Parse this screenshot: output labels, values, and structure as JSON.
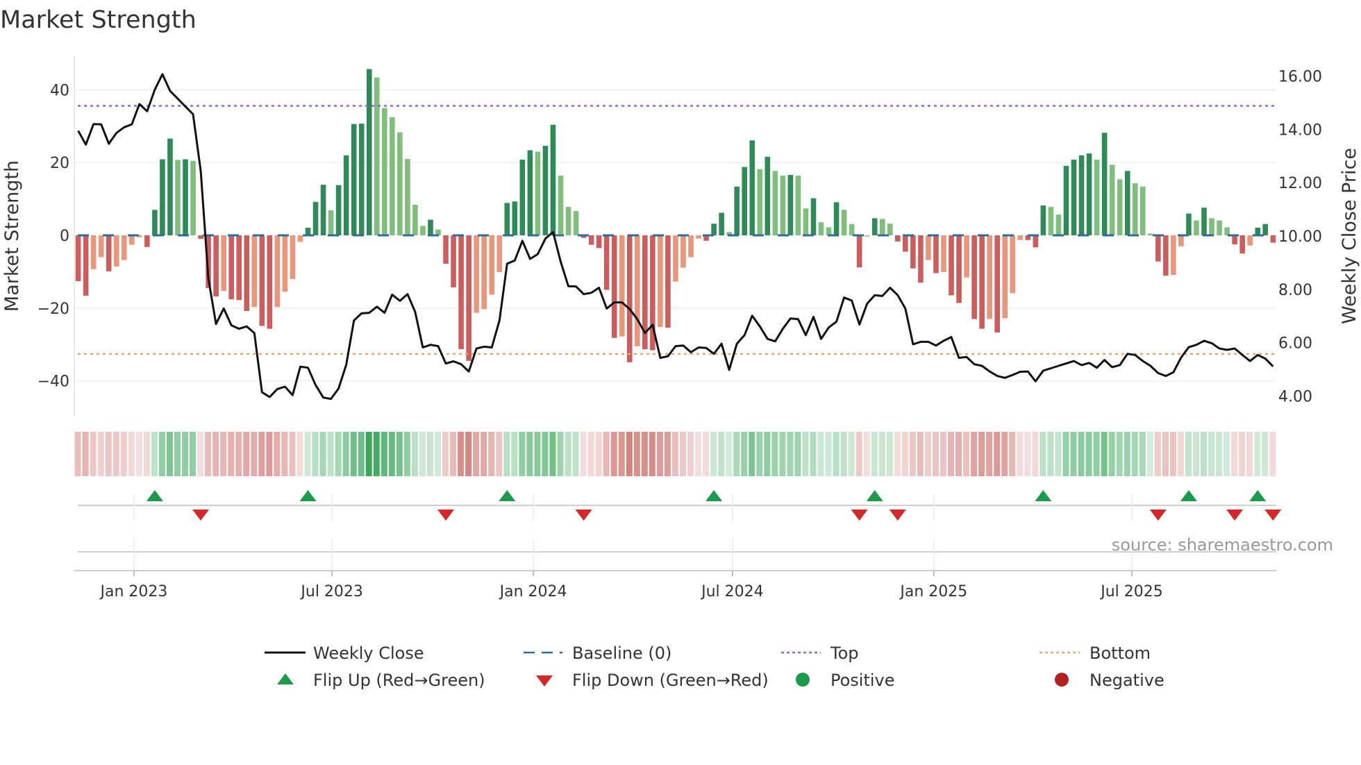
{
  "title": "Market Strength",
  "source": "source: sharemaestro.com",
  "legend": {
    "weekly_close": "Weekly Close",
    "baseline": "Baseline (0)",
    "top": "Top",
    "bottom": "Bottom",
    "flip_up": "Flip Up (Red→Green)",
    "flip_down": "Flip Down (Green→Red)",
    "positive": "Positive",
    "negative": "Negative"
  },
  "colors": {
    "green_strong": "#2e8b57",
    "green_weak": "#7fbf7b",
    "red_strong": "#cd5c5c",
    "red_weak": "#e9967a",
    "heat_green": "#31a354",
    "heat_red": "#c8605a",
    "baseline": "#2c6e9b",
    "top": "#9b5de5",
    "bottom": "#f4a460",
    "close": "#111111",
    "flip_up": "#1a9a4a",
    "flip_down": "#d62728",
    "negative": "#b22222"
  },
  "chart_data": {
    "type": "bar",
    "title": "Market Strength",
    "ylabel": "Market Strength",
    "y2label": "Weekly Close Price",
    "ylim": [
      -50,
      49.4
    ],
    "y2lim": [
      3.45,
      16.5
    ],
    "yticks": [
      -40,
      -20,
      0,
      20,
      40
    ],
    "y2ticks": [
      "4.00",
      "6.00",
      "8.00",
      "10.00",
      "12.00",
      "14.00",
      "16.00"
    ],
    "xticks": [
      {
        "date": "2023-01-01",
        "label": "Jan 2023"
      },
      {
        "date": "2023-07-01",
        "label": "Jul 2023"
      },
      {
        "date": "2024-01-01",
        "label": "Jan 2024"
      },
      {
        "date": "2024-07-01",
        "label": "Jul 2024"
      },
      {
        "date": "2025-01-01",
        "label": "Jan 2025"
      },
      {
        "date": "2025-07-01",
        "label": "Jul 2025"
      }
    ],
    "start_date": "2022-11-11",
    "frequency": "weekly",
    "top_level": 35.6,
    "bottom_level": -32.6,
    "baseline": 0,
    "strength": [
      -12.6,
      -16.6,
      -9.3,
      -6,
      -9.9,
      -8.6,
      -6.8,
      -2.6,
      -0.5,
      -3.2,
      7,
      20.9,
      26.6,
      20.7,
      20.9,
      20.5,
      -1,
      -14.5,
      -16.8,
      -15.3,
      -17.6,
      -17.8,
      -20.8,
      -19.7,
      -24.9,
      -25.7,
      -19.7,
      -15.5,
      -12,
      -1.8,
      2.1,
      9.2,
      13.9,
      6.9,
      13.8,
      22,
      30.6,
      30.7,
      45.7,
      43.4,
      35,
      32.5,
      28.3,
      21,
      8.4,
      2.6,
      4.3,
      1.6,
      -7.8,
      -14.3,
      -31.3,
      -34.5,
      -21.3,
      -20.3,
      -16.3,
      -10.1,
      8.9,
      9.3,
      20.8,
      23.4,
      23,
      24.6,
      30.4,
      16.4,
      7.8,
      6.7,
      -0.7,
      -2.6,
      -3.5,
      -15,
      -28.2,
      -27.8,
      -34.9,
      -30.5,
      -31.3,
      -31.6,
      -25.2,
      -25.4,
      -12.7,
      -8.9,
      -6,
      -0.9,
      -1.5,
      3.2,
      6.2,
      0.9,
      13.4,
      18.8,
      26.1,
      18.2,
      21.6,
      17.7,
      16.4,
      16.6,
      16.4,
      7.4,
      10.2,
      3.6,
      2.2,
      9.1,
      7,
      3.1,
      -8.8,
      -0.3,
      4.7,
      4.5,
      3.2,
      -1.7,
      -4.5,
      -9.1,
      -13,
      -6.8,
      -10.4,
      -10.1,
      -16.5,
      -18.6,
      -11.6,
      -23,
      -25.7,
      -23,
      -26.7,
      -22.8,
      -15.9,
      -1.3,
      -1.3,
      -3.3,
      8.2,
      7.8,
      5.7,
      19.1,
      20.8,
      22,
      22.5,
      20.8,
      28.2,
      19.4,
      15.4,
      17.7,
      14.3,
      13.4,
      0.5,
      -7.2,
      -11.1,
      -10.9,
      -3,
      6,
      4.1,
      7.6,
      4.7,
      4.1,
      2.2,
      -2.5,
      -5,
      -2.8,
      2.1,
      3.1,
      -2
    ],
    "weekly_close": [
      13.95,
      13.43,
      14.2,
      14.19,
      13.46,
      13.87,
      14.08,
      14.19,
      14.95,
      14.68,
      15.49,
      16.07,
      15.44,
      15.15,
      14.86,
      14.57,
      12.44,
      8.4,
      6.7,
      7.28,
      6.65,
      6.52,
      6.61,
      6.36,
      4.14,
      3.96,
      4.26,
      4.35,
      4.03,
      5.1,
      5.06,
      4.41,
      3.94,
      3.89,
      4.28,
      5.17,
      6.83,
      7.1,
      7.12,
      7.35,
      7.12,
      7.8,
      7.57,
      7.82,
      7.15,
      5.82,
      5.92,
      5.87,
      5.22,
      5.3,
      5.19,
      4.92,
      5.78,
      5.85,
      5.82,
      6.83,
      8.96,
      9.08,
      9.82,
      9.14,
      9.32,
      9.9,
      10.15,
      9.03,
      8.12,
      8.11,
      7.82,
      7.87,
      8.06,
      7.28,
      7.51,
      7.51,
      7.26,
      6.88,
      6.36,
      6.67,
      5.43,
      5.49,
      5.87,
      5.89,
      5.64,
      5.82,
      5.8,
      5.58,
      5.96,
      4.98,
      5.96,
      6.28,
      7.01,
      6.61,
      6.14,
      6.05,
      6.52,
      6.91,
      6.88,
      6.28,
      6.97,
      6.14,
      6.57,
      6.79,
      7.69,
      7.58,
      6.68,
      7.46,
      7.78,
      7.75,
      8.06,
      7.78,
      7.28,
      5.94,
      6.03,
      6.03,
      5.89,
      6.07,
      6.21,
      5.43,
      5.46,
      5.19,
      5.13,
      4.92,
      4.75,
      4.68,
      4.79,
      4.91,
      4.92,
      4.55,
      4.95,
      5.04,
      5.13,
      5.22,
      5.31,
      5.16,
      5.24,
      5.06,
      5.35,
      5.08,
      5.16,
      5.58,
      5.54,
      5.31,
      5.13,
      4.86,
      4.75,
      4.89,
      5.44,
      5.83,
      5.92,
      6.07,
      5.98,
      5.78,
      5.73,
      5.78,
      5.54,
      5.31,
      5.54,
      5.4,
      5.11
    ]
  }
}
